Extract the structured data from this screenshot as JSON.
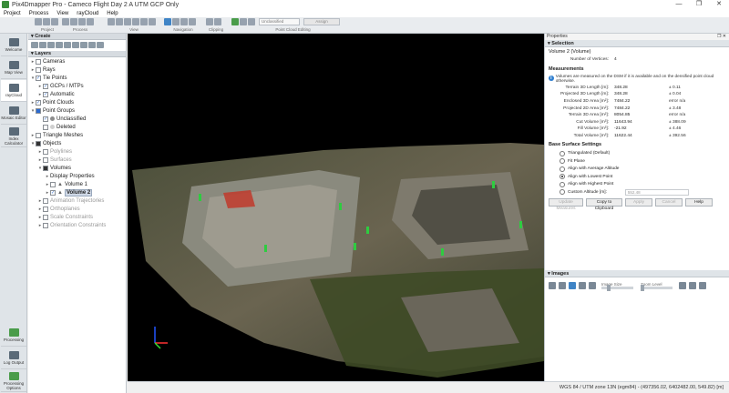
{
  "window": {
    "title": "Pix4Dmapper Pro - Cameco Flight Day 2 A UTM GCP Only"
  },
  "menu": [
    "Project",
    "Process",
    "View",
    "rayCloud",
    "Help"
  ],
  "toolbar": {
    "groups": [
      "Project",
      "Process",
      "View",
      "Navigation",
      "Clipping",
      "Point Cloud Editing"
    ],
    "class_dropdown": "Unclassified",
    "assign_label": "Assign"
  },
  "sidebar": [
    {
      "label": "Welcome",
      "icon": "home-icon"
    },
    {
      "label": "Map View",
      "icon": "map-icon"
    },
    {
      "label": "rayCloud",
      "icon": "raycloud-icon",
      "active": true
    },
    {
      "label": "Mosaic Editor",
      "icon": "mosaic-icon"
    },
    {
      "label": "Index Calculator",
      "icon": "index-icon"
    }
  ],
  "sidebar_bottom": [
    {
      "label": "Processing",
      "icon": "processing-icon"
    },
    {
      "label": "Log Output",
      "icon": "log-icon"
    },
    {
      "label": "Processing Options",
      "icon": "options-icon"
    }
  ],
  "create": {
    "title": "Create"
  },
  "layers": {
    "title": "Layers",
    "cameras": "Cameras",
    "rays": "Rays",
    "tie_points": "Tie Points",
    "gcps": "GCPs / MTPs",
    "automatic": "Automatic",
    "point_clouds": "Point Clouds",
    "point_groups": "Point Groups",
    "unclassified": "Unclassified",
    "deleted": "Deleted",
    "triangle_meshes": "Triangle Meshes",
    "objects": "Objects",
    "polylines": "Polylines",
    "surfaces": "Surfaces",
    "volumes": "Volumes",
    "display_properties": "Display Properties",
    "volume1": "Volume 1",
    "volume2": "Volume 2",
    "animation": "Animation Trajectories",
    "orthoplanes": "Orthoplanes",
    "scale": "Scale Constraints",
    "orientation": "Orientation Constraints"
  },
  "properties": {
    "title": "Properties",
    "selection_header": "Selection",
    "selected_name": "Volume 2 (Volume)",
    "vertices_label": "Number of Vertices:",
    "vertices_value": "4",
    "measurements_title": "Measurements",
    "info_text": "Volumes are measured on the DSM if it is available and on the densified point cloud otherwise.",
    "measurements": [
      {
        "label": "Terrain 3D Length [m]:",
        "value": "348.28",
        "error": "± 0.11"
      },
      {
        "label": "Projected 3D Length [m]:",
        "value": "348.28",
        "error": "± 0.04"
      },
      {
        "label": "Enclosed 3D Area [m²]:",
        "value": "7484.22",
        "error": "error n/a"
      },
      {
        "label": "Projected 2D Area [m²]:",
        "value": "7484.22",
        "error": "± 3.48"
      },
      {
        "label": "Terrain 3D Area [m²]:",
        "value": "8054.85",
        "error": "error n/a"
      },
      {
        "label": "Cut Volume [m³]:",
        "value": "11643.94",
        "error": "± 388.09"
      },
      {
        "label": "Fill Volume [m³]:",
        "value": "-21.92",
        "error": "± 4.46"
      },
      {
        "label": "Total Volume [m³]:",
        "value": "11622.44",
        "error": "± 392.56"
      }
    ],
    "base_title": "Base Surface Settings",
    "base_options": [
      {
        "label": "Triangulated (Default)",
        "selected": false
      },
      {
        "label": "Fit Plane",
        "selected": false
      },
      {
        "label": "Align with Average Altitude",
        "selected": false
      },
      {
        "label": "Align with Lowest Point",
        "selected": true
      },
      {
        "label": "Align with Highest Point",
        "selected": false
      },
      {
        "label": "Custom Altitude [m]:",
        "selected": false
      }
    ],
    "custom_altitude": "552.48",
    "buttons": [
      "Update Measures",
      "Copy to Clipboard",
      "Apply",
      "Cancel",
      "Help"
    ],
    "images_header": "Images",
    "image_size_label": "Image Size",
    "zoom_level_label": "Zoom Level"
  },
  "status": {
    "text": "WGS 84 / UTM zone 13N (egm84) - (497356.02, 6402482.00, 549.82) [m]"
  }
}
